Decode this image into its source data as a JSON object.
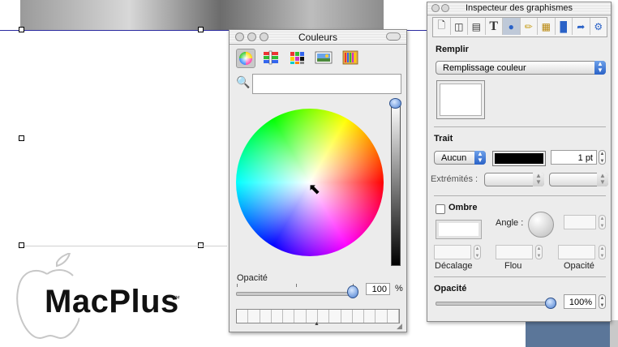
{
  "document": {
    "logo_text": "MacPlus",
    "logo_tm": "™"
  },
  "colors_panel": {
    "title": "Couleurs",
    "modes": [
      {
        "icon": "color-wheel-icon",
        "selected": true
      },
      {
        "icon": "color-sliders-icon",
        "selected": false
      },
      {
        "icon": "color-palettes-icon",
        "selected": false
      },
      {
        "icon": "image-palette-icon",
        "selected": false
      },
      {
        "icon": "crayons-icon",
        "selected": false
      }
    ],
    "search_value": "",
    "brightness_level": 1.0,
    "opacity_label": "Opacité",
    "opacity_value": "100",
    "opacity_unit": "%",
    "opacity_level": 1.0,
    "swatch_count": 14
  },
  "inspector": {
    "title": "Inspecteur des graphismes",
    "toolbar_icons": [
      "document-icon",
      "layout-icon",
      "wrap-icon",
      "text-icon",
      "graphic-icon",
      "metrics-icon",
      "table-icon",
      "chart-icon",
      "link-icon",
      "quicktime-icon"
    ],
    "selected_tool": 4,
    "fill": {
      "label": "Remplir",
      "type": "Remplissage couleur",
      "swatch_color": "#ffffff"
    },
    "stroke": {
      "label": "Trait",
      "style": "Aucun",
      "color": "#000000",
      "width": "1 pt",
      "endpoints_label": "Extrémités :"
    },
    "shadow": {
      "label": "Ombre",
      "enabled": false,
      "angle_label": "Angle :",
      "offset_label": "Décalage",
      "blur_label": "Flou",
      "opacity_label": "Opacité"
    },
    "opacity": {
      "label": "Opacité",
      "value": "100%",
      "level": 1.0
    }
  }
}
